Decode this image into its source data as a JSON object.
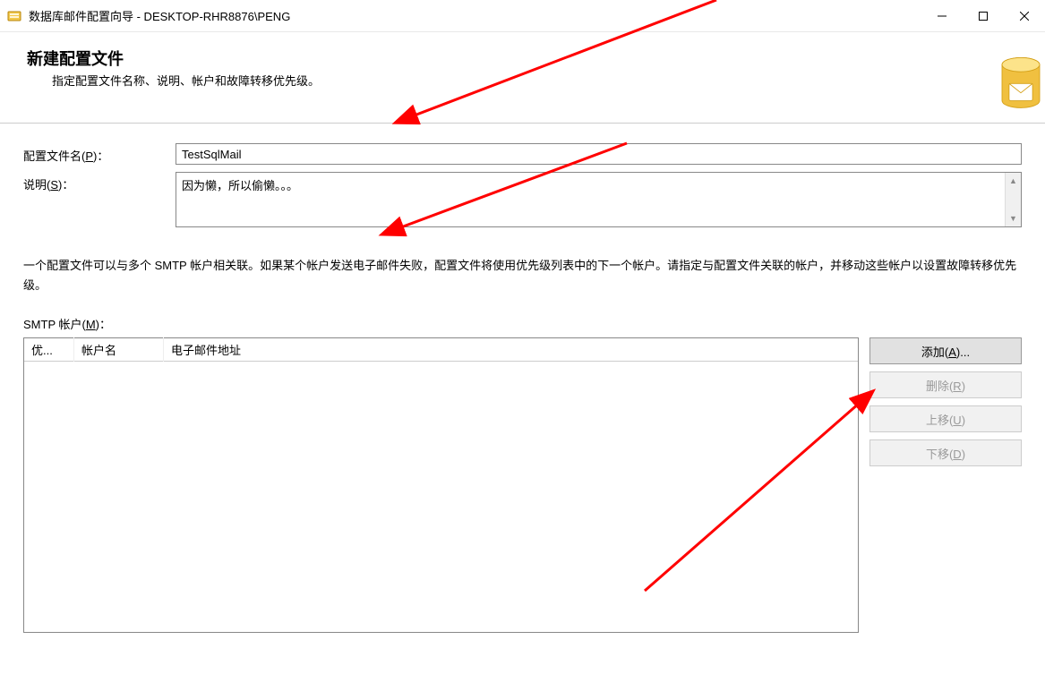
{
  "window": {
    "title": "数据库邮件配置向导 - DESKTOP-RHR8876\\PENG"
  },
  "header": {
    "title": "新建配置文件",
    "subtitle": "指定配置文件名称、说明、帐户和故障转移优先级。"
  },
  "form": {
    "profile_name_label_pre": "配置文件名(",
    "profile_name_hotkey": "P",
    "profile_name_label_post": ")：",
    "profile_name_value": "TestSqlMail",
    "desc_label_pre": "说明(",
    "desc_hotkey": "S",
    "desc_label_post": ")：",
    "desc_value": "因为懒，所以偷懒。。。"
  },
  "info": "一个配置文件可以与多个 SMTP 帐户相关联。如果某个帐户发送电子邮件失败，配置文件将使用优先级列表中的下一个帐户。请指定与配置文件关联的帐户，并移动这些帐户以设置故障转移优先级。",
  "smtp": {
    "label_pre": "SMTP 帐户(",
    "label_hotkey": "M",
    "label_post": ")：",
    "columns": {
      "priority": "优...",
      "name": "帐户名",
      "email": "电子邮件地址"
    }
  },
  "buttons": {
    "add_pre": "添加(",
    "add_hk": "A",
    "add_post": ")...",
    "remove_pre": "删除(",
    "remove_hk": "R",
    "remove_post": ")",
    "up_pre": "上移(",
    "up_hk": "U",
    "up_post": ")",
    "down_pre": "下移(",
    "down_hk": "D",
    "down_post": ")"
  }
}
